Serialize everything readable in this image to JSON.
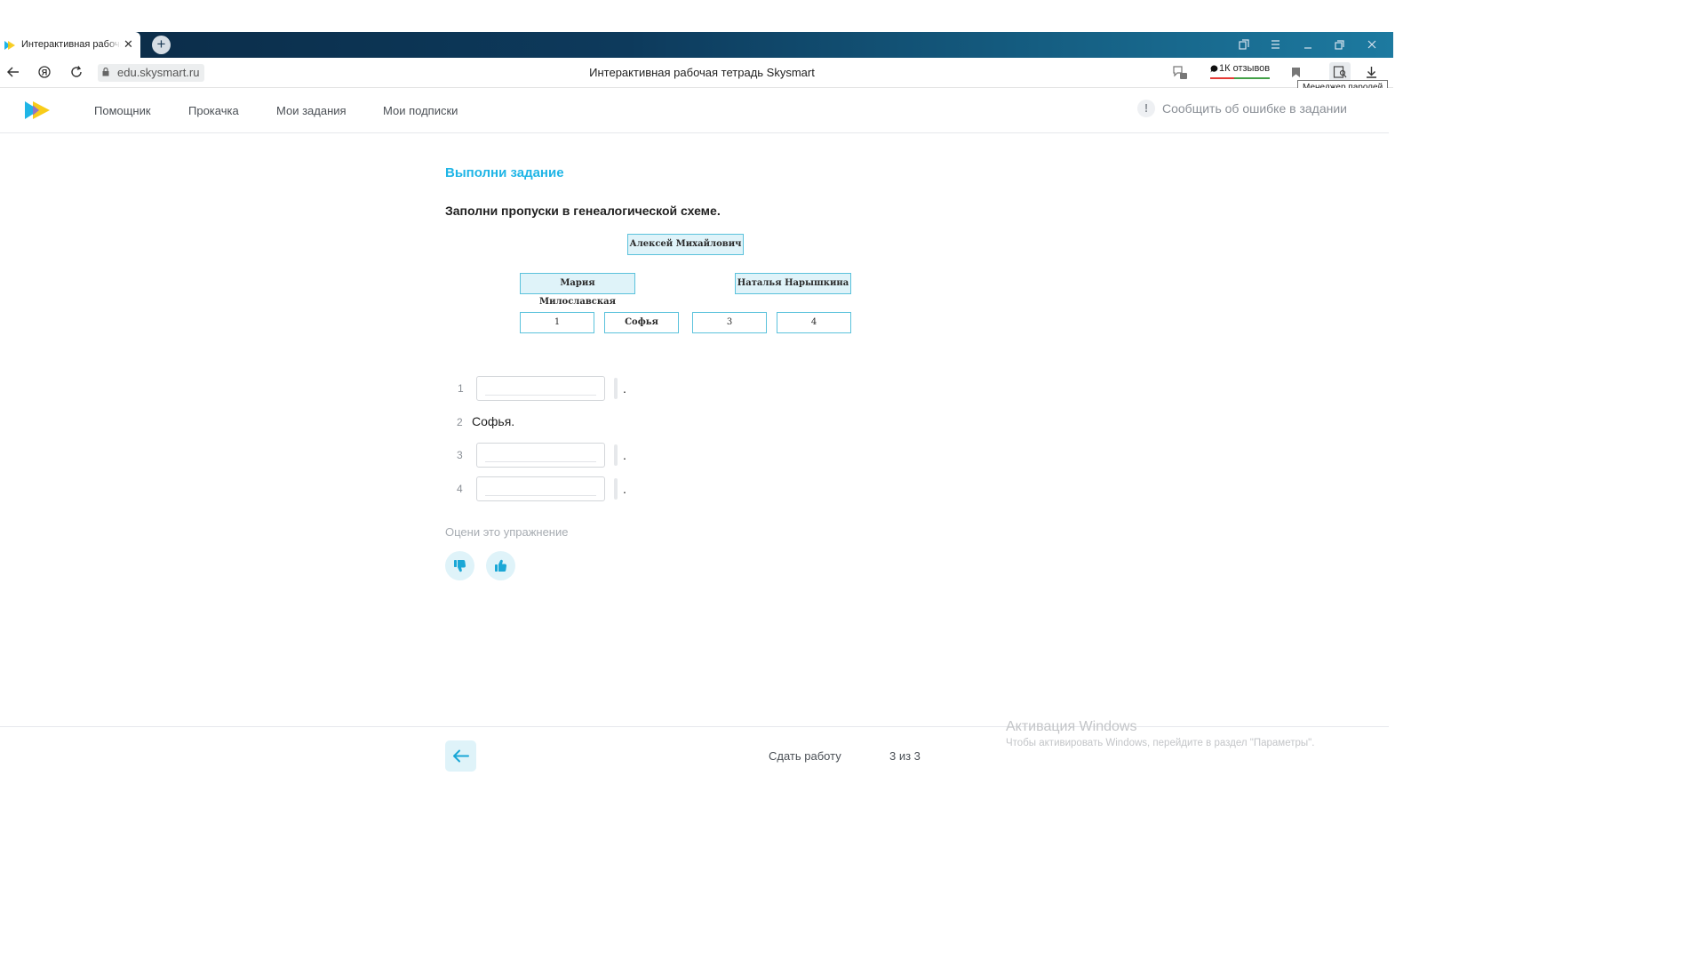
{
  "browser": {
    "tab_title": "Интерактивная рабочая тетрадь Skysmart",
    "tab_close": "✕",
    "new_tab": "+",
    "url": "edu.skysmart.ru",
    "page_title": "Интерактивная рабочая тетрадь Skysmart",
    "reviews": "1К отзывов",
    "tooltip": "Менеджер паролей",
    "icons": [
      "back-icon",
      "yandex-icon",
      "reload-icon",
      "lock-icon",
      "protect-icon",
      "bookmark-icon",
      "password-manager-icon",
      "download-icon"
    ],
    "window_controls": [
      "bookmarks-panel-icon",
      "menu-icon",
      "minimize-icon",
      "restore-icon",
      "close-icon"
    ]
  },
  "header": {
    "nav": [
      "Помощник",
      "Прокачка",
      "Мои задания",
      "Мои подписки"
    ],
    "report": "Сообщить об ошибке в задании",
    "report_icon": "!"
  },
  "task": {
    "heading": "Выполни задание",
    "instruction": "Заполни пропуски в генеалогической схеме."
  },
  "scheme": {
    "root": "Алексей Михайлович",
    "parents": [
      "Мария Милославская",
      "Наталья Нарышкина"
    ],
    "children": [
      "1",
      "Софья",
      "3",
      "4"
    ]
  },
  "answers": [
    {
      "num": "1",
      "value": "",
      "dot": "."
    },
    {
      "num": "2",
      "text": "Софья."
    },
    {
      "num": "3",
      "value": "",
      "dot": "."
    },
    {
      "num": "4",
      "value": "",
      "dot": "."
    }
  ],
  "rating": {
    "label": "Оцени это упражнение"
  },
  "footer": {
    "submit": "Сдать работу",
    "counter": "3 из 3"
  },
  "windows_activation": {
    "title": "Активация Windows",
    "subtitle": "Чтобы активировать Windows, перейдите в раздел \"Параметры\"."
  },
  "colors": {
    "accent": "#1fb5e6",
    "node_border": "#5bc2dc",
    "node_fill": "#dff3f9"
  }
}
